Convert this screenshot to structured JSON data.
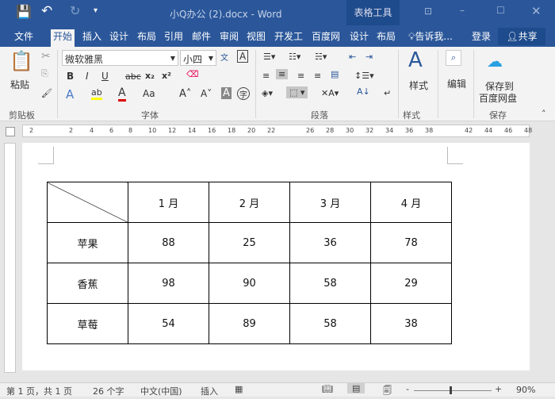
{
  "titlebar": {
    "title": "小Q办公 (2).docx - Word",
    "context_tab": "表格工具",
    "qat": {
      "save": "save-icon",
      "undo": "undo-icon",
      "redo": "redo-icon"
    }
  },
  "tabs": [
    "文件",
    "开始",
    "插入",
    "设计",
    "布局",
    "引用",
    "邮件",
    "审阅",
    "视图",
    "开发工",
    "百度网",
    "设计",
    "布局"
  ],
  "tell_me": "告诉我...",
  "login": "登录",
  "share": "共享",
  "ribbon": {
    "paste": "粘贴",
    "font_name": "微软雅黑",
    "font_size": "小四",
    "styles": "样式",
    "edit": "编辑",
    "save_to": "保存到",
    "baidu": "百度网盘",
    "groups": [
      "剪贴板",
      "字体",
      "段落",
      "样式",
      "保存"
    ]
  },
  "ruler_ticks": [
    "2",
    "2",
    "4",
    "6",
    "8",
    "10",
    "12",
    "14",
    "16",
    "18",
    "20",
    "22",
    "26",
    "28",
    "30",
    "32",
    "34",
    "36",
    "38",
    "42",
    "44",
    "46",
    "48"
  ],
  "table": {
    "header": [
      "",
      "1 月",
      "2 月",
      "3 月",
      "4 月"
    ],
    "rows": [
      [
        "苹果",
        "88",
        "25",
        "36",
        "78"
      ],
      [
        "香蕉",
        "98",
        "90",
        "58",
        "29"
      ],
      [
        "草莓",
        "54",
        "89",
        "58",
        "38"
      ]
    ]
  },
  "status": {
    "page": "第 1 页，共 1 页",
    "words": "26 个字",
    "lang": "中文(中国)",
    "mode": "插入",
    "zoom": "90%",
    "zoom_minus": "-",
    "zoom_plus": "+"
  },
  "colors": {
    "brand": "#2b579a"
  }
}
